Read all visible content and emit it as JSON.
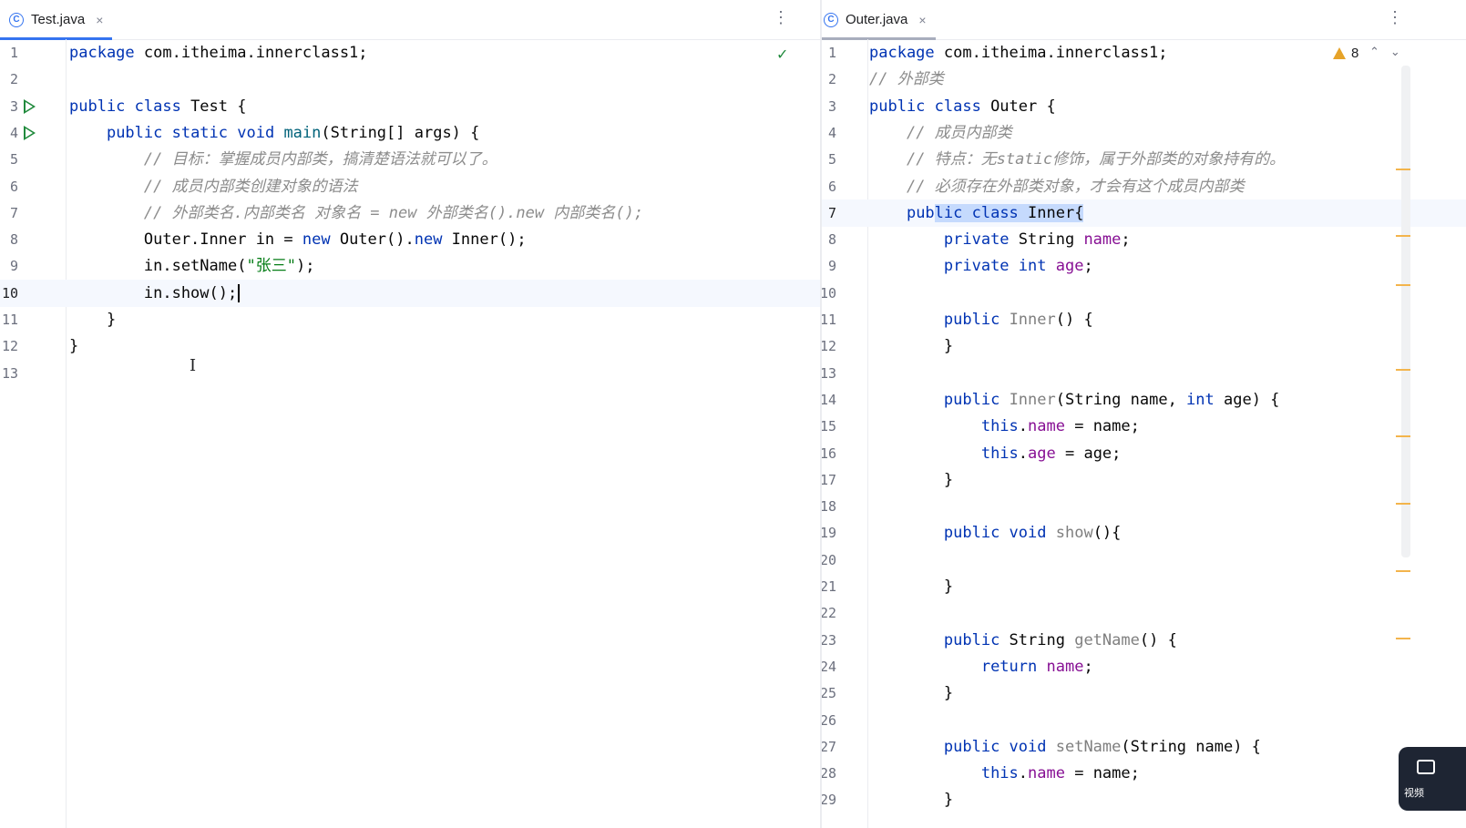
{
  "left_editor": {
    "tab": {
      "icon": "class-icon",
      "title": "Test.java",
      "close": "×"
    },
    "more": "⋮",
    "status": "inspection-ok-check-icon",
    "lines": [
      {
        "n": "1",
        "html": "<span class=\"kw\">package</span> com.itheima.innerclass1;"
      },
      {
        "n": "2",
        "html": ""
      },
      {
        "n": "3",
        "html": "<span class=\"kw\">public class</span> Test {",
        "run": true
      },
      {
        "n": "4",
        "html": "    <span class=\"kw\">public static void</span> <span class=\"fn\">main</span>(String[] args) {",
        "run": true
      },
      {
        "n": "5",
        "html": "        <span class=\"cm\">// 目标：掌握成员内部类，搞清楚语法就可以了。</span>"
      },
      {
        "n": "6",
        "html": "        <span class=\"cm\">// 成员内部类创建对象的语法</span>"
      },
      {
        "n": "7",
        "html": "        <span class=\"cm\">// 外部类名.内部类名 对象名 = new 外部类名().new 内部类名();</span>"
      },
      {
        "n": "8",
        "html": "        Outer.Inner in = <span class=\"kw\">new</span> Outer().<span class=\"kw\">new</span> Inner();"
      },
      {
        "n": "9",
        "html": "        in.setName(<span class=\"st\">\"张三\"</span>);"
      },
      {
        "n": "10",
        "html": "        in.show();<span class=\"caret\"></span>",
        "current": true
      },
      {
        "n": "11",
        "html": "    }"
      },
      {
        "n": "12",
        "html": "}"
      },
      {
        "n": "13",
        "html": ""
      }
    ]
  },
  "right_editor": {
    "tab": {
      "icon": "class-icon",
      "title": "Outer.java",
      "close": "×"
    },
    "more": "⋮",
    "warnings": {
      "count": "8"
    },
    "nav": "⌃⌄",
    "lines": [
      {
        "n": "1",
        "html": "<span class=\"kw\">package</span> com.itheima.innerclass1;"
      },
      {
        "n": "2",
        "html": "<span class=\"cm\">// 外部类</span>"
      },
      {
        "n": "3",
        "html": "<span class=\"kw\">public class</span> Outer {"
      },
      {
        "n": "4",
        "html": "    <span class=\"cm\">// 成员内部类</span>"
      },
      {
        "n": "5",
        "html": "    <span class=\"cm\">// 特点：无static修饰，属于外部类的对象持有的。</span>"
      },
      {
        "n": "6",
        "html": "    <span class=\"cm\">// 必须存在外部类对象，才会有这个成员内部类</span>"
      },
      {
        "n": "7",
        "html": "    <span class=\"kw\">pub</span><span class=\"sel\"><span class=\"kw\">lic class</span> Inner{</span>",
        "current": true
      },
      {
        "n": "8",
        "html": "        <span class=\"kw\">private</span> String <span class=\"fld\">name</span>;"
      },
      {
        "n": "9",
        "html": "        <span class=\"kw\">private int</span> <span class=\"fld\">age</span>;"
      },
      {
        "n": "10",
        "html": ""
      },
      {
        "n": "11",
        "html": "        <span class=\"kw\">public</span> <span class=\"dfn\">Inner</span>() {"
      },
      {
        "n": "12",
        "html": "        }"
      },
      {
        "n": "13",
        "html": ""
      },
      {
        "n": "14",
        "html": "        <span class=\"kw\">public</span> <span class=\"dfn\">Inner</span>(String name, <span class=\"kw\">int</span> age) {"
      },
      {
        "n": "15",
        "html": "            <span class=\"kw\">this</span>.<span class=\"fld\">name</span> = name;"
      },
      {
        "n": "16",
        "html": "            <span class=\"kw\">this</span>.<span class=\"fld\">age</span> = age;"
      },
      {
        "n": "17",
        "html": "        }"
      },
      {
        "n": "18",
        "html": ""
      },
      {
        "n": "19",
        "html": "        <span class=\"kw\">public void</span> <span class=\"dfn\">show</span>(){"
      },
      {
        "n": "20",
        "html": ""
      },
      {
        "n": "21",
        "html": "        }"
      },
      {
        "n": "22",
        "html": ""
      },
      {
        "n": "23",
        "html": "        <span class=\"kw\">public</span> String <span class=\"dfn\">getName</span>() {"
      },
      {
        "n": "24",
        "html": "            <span class=\"kw\">return</span> <span class=\"fld\">name</span>;"
      },
      {
        "n": "25",
        "html": "        }"
      },
      {
        "n": "26",
        "html": ""
      },
      {
        "n": "27",
        "html": "        <span class=\"kw\">public void</span> <span class=\"dfn\">setName</span>(String name) {"
      },
      {
        "n": "28",
        "html": "            <span class=\"kw\">this</span>.<span class=\"fld\">name</span> = name;"
      },
      {
        "n": "29",
        "html": "        }"
      }
    ]
  },
  "overlay_widget": {
    "label": "视频"
  }
}
